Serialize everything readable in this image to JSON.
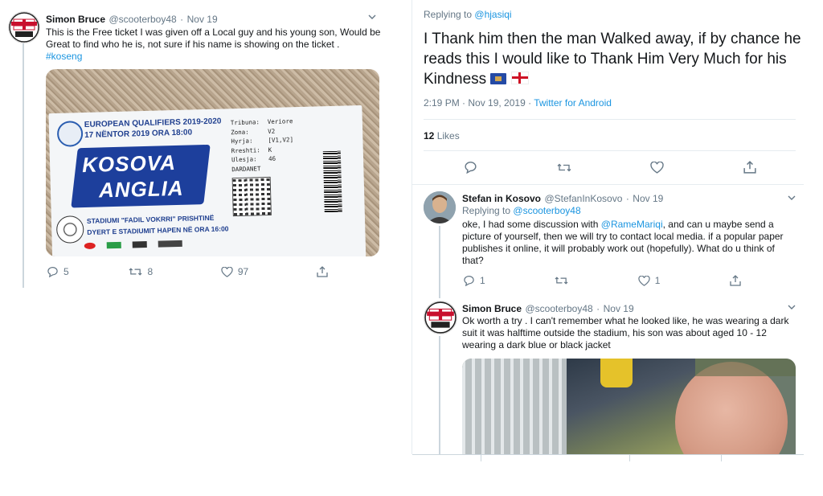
{
  "left_tweet": {
    "name": "Simon Bruce",
    "handle": "@scooterboy48",
    "separator": "·",
    "date": "Nov 19",
    "text": "This is the Free ticket I was given off a Local guy and his young son,  Would be Great to find who he is, not sure if his name is showing on the ticket .",
    "hashtag": "#koseng",
    "replies": "5",
    "retweets": "8",
    "likes": "97",
    "ticket": {
      "headline": "EUROPEAN QUALIFIERS 2019-2020",
      "date_line": "17 NËNTOR 2019 ORA 18:00",
      "team_home": "KOSOVA",
      "team_away": "ANGLIA",
      "stadium": "STADIUMI \"FADIL VOKRRI\" PRISHTINË",
      "gates": "DYERT E STADIUMIT HAPEN NË ORA 16:00",
      "fields": [
        {
          "label": "Tribuna:",
          "value": "Veriore"
        },
        {
          "label": "Zona:",
          "value": "V2"
        },
        {
          "label": "Hyrja:",
          "value": "[V1,V2]"
        },
        {
          "label": "Rreshti:",
          "value": "K"
        },
        {
          "label": "Ulesja:",
          "value": "46"
        }
      ],
      "sector": "DARDANET"
    }
  },
  "main_tweet": {
    "replying_prefix": "Replying to",
    "replying_to": "@hjasiqi",
    "text": "I Thank him then the man Walked away, if by chance he reads this I would like to Thank Him Very Much for his Kindness",
    "time": "2:19 PM · Nov 19, 2019",
    "separator": "·",
    "source": "Twitter for Android",
    "likes_count": "12",
    "likes_label": "Likes"
  },
  "reply_stefan": {
    "name": "Stefan in Kosovo",
    "handle": "@StefanInKosovo",
    "separator": "·",
    "date": "Nov 19",
    "replying_prefix": "Replying to",
    "replying_to": "@scooterboy48",
    "text_before": "oke, I had some discussion with ",
    "mention": "@RameMariqi",
    "text_after": ", and can u maybe send a picture of yourself, then we will try to contact local media. if a popular paper publishes it online, it will probably work out (hopefully). What do u think of that?",
    "replies": "1",
    "likes": "1"
  },
  "reply_simon": {
    "name": "Simon Bruce",
    "handle": "@scooterboy48",
    "separator": "·",
    "date": "Nov 19",
    "text": "Ok worth a try . I can't remember what he looked like, he was wearing a dark suit it was halftime outside the stadium,  his son was about aged 10 - 12 wearing a dark blue or black jacket"
  },
  "colors": {
    "link": "#1b95e0",
    "muted": "#657786",
    "text": "#14171a",
    "divider": "#e6ecf0"
  }
}
